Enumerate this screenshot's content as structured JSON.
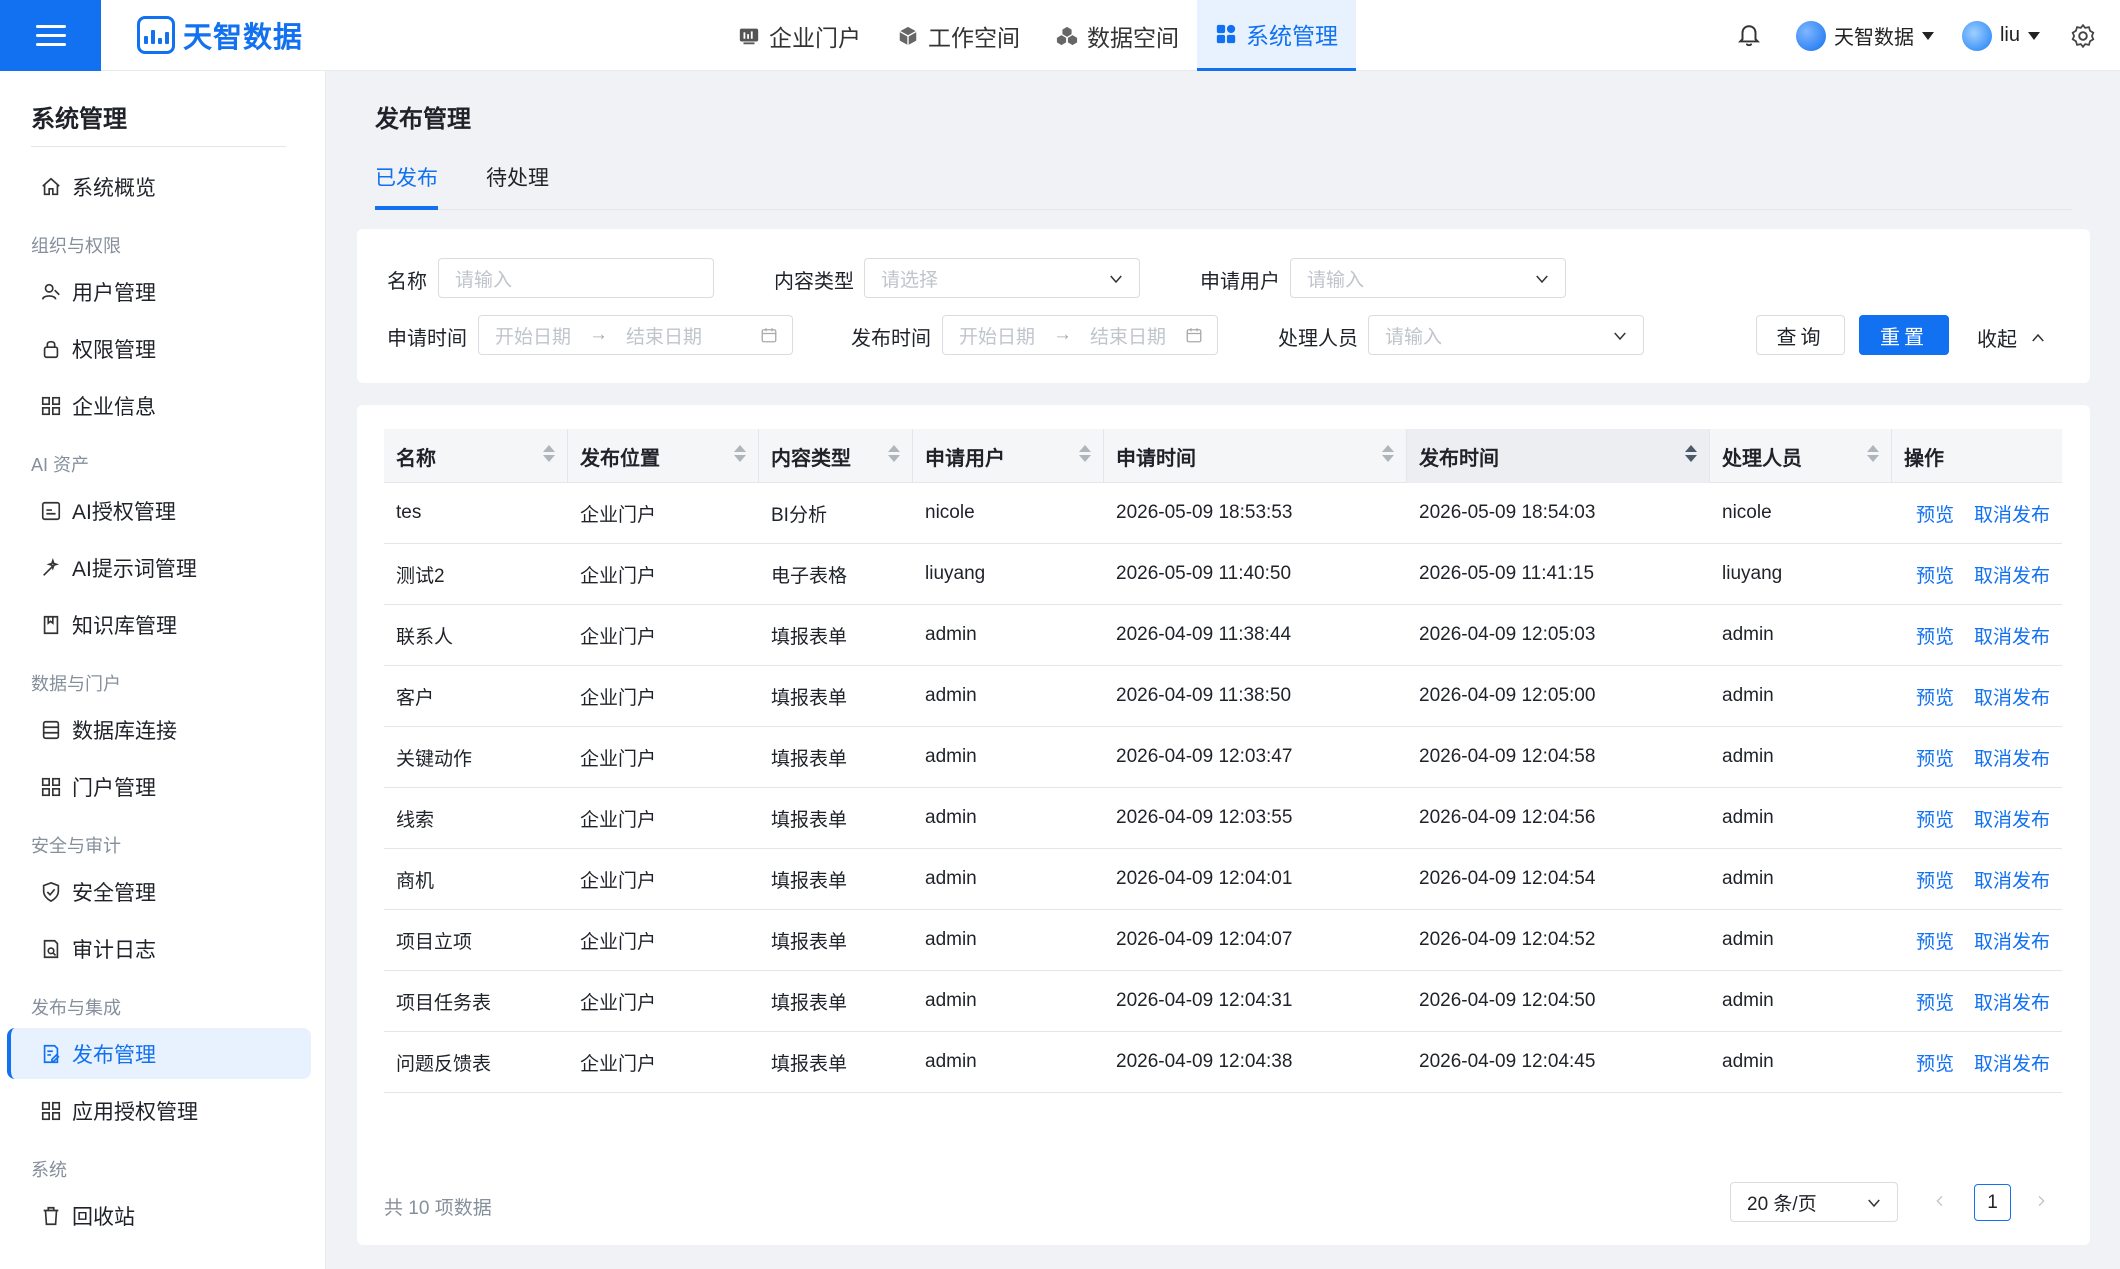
{
  "topbar": {
    "brand": "天智数据",
    "nav": [
      {
        "label": "企业门户",
        "icon": "dashboard-icon",
        "active": false
      },
      {
        "label": "工作空间",
        "icon": "cube-icon",
        "active": false
      },
      {
        "label": "数据空间",
        "icon": "cubes-icon",
        "active": false
      },
      {
        "label": "系统管理",
        "icon": "grid-icon",
        "active": true
      }
    ],
    "org": "天智数据",
    "user": "liu"
  },
  "sidebar": {
    "title": "系统管理",
    "overview": "系统概览",
    "groups": {
      "org": "组织与权限",
      "ai": "AI 资产",
      "data": "数据与门户",
      "security": "安全与审计",
      "publish": "发布与集成",
      "system": "系统"
    },
    "items": {
      "users": "用户管理",
      "permissions": "权限管理",
      "company": "企业信息",
      "ai_auth": "AI授权管理",
      "ai_prompt": "AI提示词管理",
      "knowledge": "知识库管理",
      "db_conn": "数据库连接",
      "portal": "门户管理",
      "safety": "安全管理",
      "audit": "审计日志",
      "publish": "发布管理",
      "app_auth": "应用授权管理",
      "recycle": "回收站"
    }
  },
  "main": {
    "title": "发布管理",
    "tabs": [
      "已发布",
      "待处理"
    ]
  },
  "filters": {
    "name_label": "名称",
    "name_placeholder": "请输入",
    "type_label": "内容类型",
    "type_placeholder": "请选择",
    "applicant_label": "申请用户",
    "applicant_placeholder": "请输入",
    "apply_time_label": "申请时间",
    "publish_time_label": "发布时间",
    "start_date": "开始日期",
    "end_date": "结束日期",
    "arrow": "→",
    "handler_label": "处理人员",
    "handler_placeholder": "请输入",
    "query": "查询",
    "reset": "重置",
    "collapse": "收起"
  },
  "table": {
    "columns": [
      "名称",
      "发布位置",
      "内容类型",
      "申请用户",
      "申请时间",
      "发布时间",
      "处理人员",
      "操作"
    ],
    "preview": "预览",
    "unpublish": "取消发布",
    "rows": [
      [
        "tes",
        "企业门户",
        "BI分析",
        "nicole",
        "2026-05-09 18:53:53",
        "2026-05-09 18:54:03",
        "nicole"
      ],
      [
        "测试2",
        "企业门户",
        "电子表格",
        "liuyang",
        "2026-05-09 11:40:50",
        "2026-05-09 11:41:15",
        "liuyang"
      ],
      [
        "联系人",
        "企业门户",
        "填报表单",
        "admin",
        "2026-04-09 11:38:44",
        "2026-04-09 12:05:03",
        "admin"
      ],
      [
        "客户",
        "企业门户",
        "填报表单",
        "admin",
        "2026-04-09 11:38:50",
        "2026-04-09 12:05:00",
        "admin"
      ],
      [
        "关键动作",
        "企业门户",
        "填报表单",
        "admin",
        "2026-04-09 12:03:47",
        "2026-04-09 12:04:58",
        "admin"
      ],
      [
        "线索",
        "企业门户",
        "填报表单",
        "admin",
        "2026-04-09 12:03:55",
        "2026-04-09 12:04:56",
        "admin"
      ],
      [
        "商机",
        "企业门户",
        "填报表单",
        "admin",
        "2026-04-09 12:04:01",
        "2026-04-09 12:04:54",
        "admin"
      ],
      [
        "项目立项",
        "企业门户",
        "填报表单",
        "admin",
        "2026-04-09 12:04:07",
        "2026-04-09 12:04:52",
        "admin"
      ],
      [
        "项目任务表",
        "企业门户",
        "填报表单",
        "admin",
        "2026-04-09 12:04:31",
        "2026-04-09 12:04:50",
        "admin"
      ],
      [
        "问题反馈表",
        "企业门户",
        "填报表单",
        "admin",
        "2026-04-09 12:04:38",
        "2026-04-09 12:04:45",
        "admin"
      ]
    ]
  },
  "pagination": {
    "total_text": "共 10 项数据",
    "page_size": "20 条/页",
    "current_page": "1"
  },
  "colors": {
    "accent": "#1271f0",
    "active_bg": "#e8f2fe",
    "page_bg": "#f0f2f5"
  }
}
